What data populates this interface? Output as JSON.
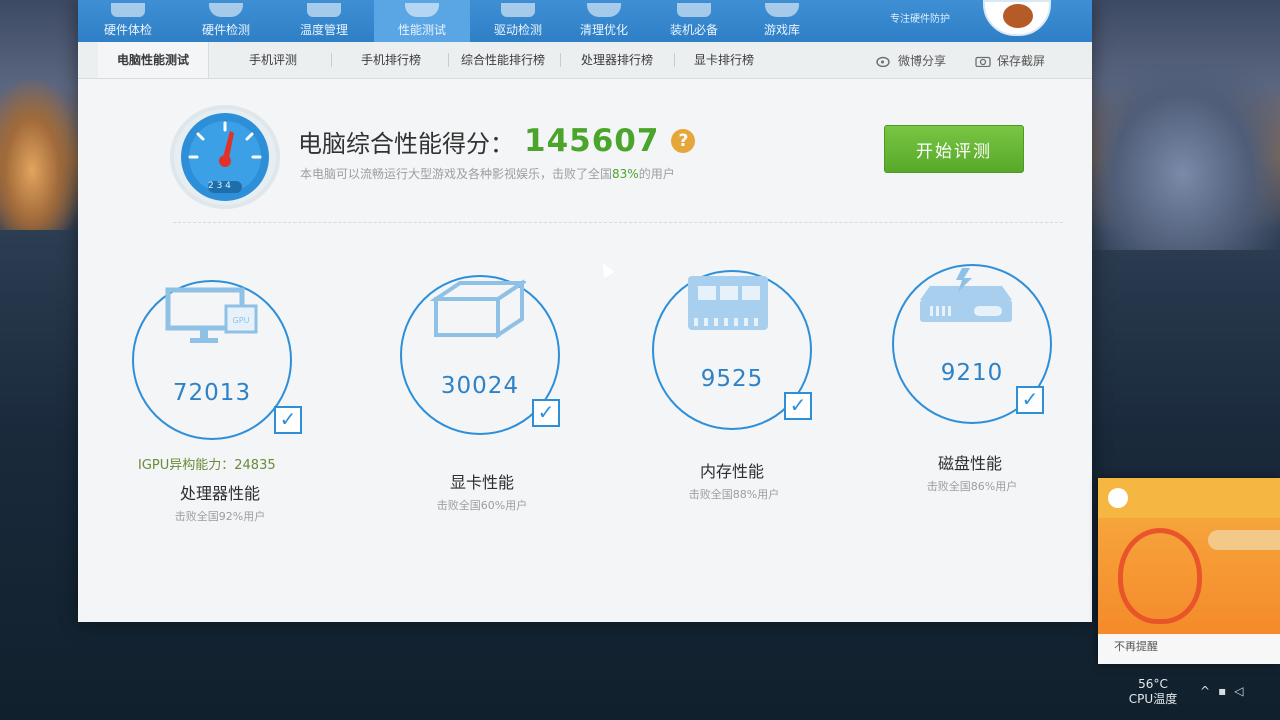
{
  "top_nav": {
    "items": [
      {
        "label": "硬件体检",
        "active": false
      },
      {
        "label": "硬件检测",
        "active": false
      },
      {
        "label": "温度管理",
        "active": false
      },
      {
        "label": "性能测试",
        "active": true
      },
      {
        "label": "驱动检测",
        "active": false
      },
      {
        "label": "清理优化",
        "active": false
      },
      {
        "label": "装机必备",
        "active": false
      },
      {
        "label": "游戏库",
        "active": false
      }
    ],
    "brand_slogan": "专注硬件防护"
  },
  "sub_nav": {
    "tabs": [
      {
        "label": "电脑性能测试",
        "active": true
      },
      {
        "label": "手机评测",
        "active": false
      },
      {
        "label": "手机排行榜",
        "active": false
      },
      {
        "label": "综合性能排行榜",
        "active": false
      },
      {
        "label": "处理器排行榜",
        "active": false
      },
      {
        "label": "显卡排行榜",
        "active": false
      }
    ],
    "share_label": "微博分享",
    "screenshot_label": "保存截屏"
  },
  "score": {
    "title": "电脑综合性能得分：",
    "value": "145607",
    "help": "?",
    "gauge_label": "2 3 4",
    "desc_before": "本电脑可以流畅运行大型游戏及各种影视娱乐，击败了全国",
    "desc_pct": "83%",
    "desc_after": "的用户",
    "start_button": "开始评测"
  },
  "metrics": [
    {
      "score": "72013",
      "extra": "IGPU异构能力：24835",
      "name": "处理器性能",
      "sub": "击败全国92%用户",
      "icon": "monitor-icon"
    },
    {
      "score": "30024",
      "name": "显卡性能",
      "sub": "击败全国60%用户",
      "icon": "gpu-box-icon"
    },
    {
      "score": "9525",
      "name": "内存性能",
      "sub": "击败全国88%用户",
      "icon": "memory-chip-icon"
    },
    {
      "score": "9210",
      "name": "磁盘性能",
      "sub": "击败全国86%用户",
      "icon": "disk-drive-icon"
    }
  ],
  "toast": {
    "footer": "不再提醒"
  },
  "taskbar": {
    "cpu_temp": "56°C",
    "cpu_temp_label": "CPU温度"
  },
  "colors": {
    "accent": "#2f7fc6",
    "score_green": "#4aa52a",
    "start_green": "#58a92a",
    "ring_blue": "#2e8fd9"
  }
}
